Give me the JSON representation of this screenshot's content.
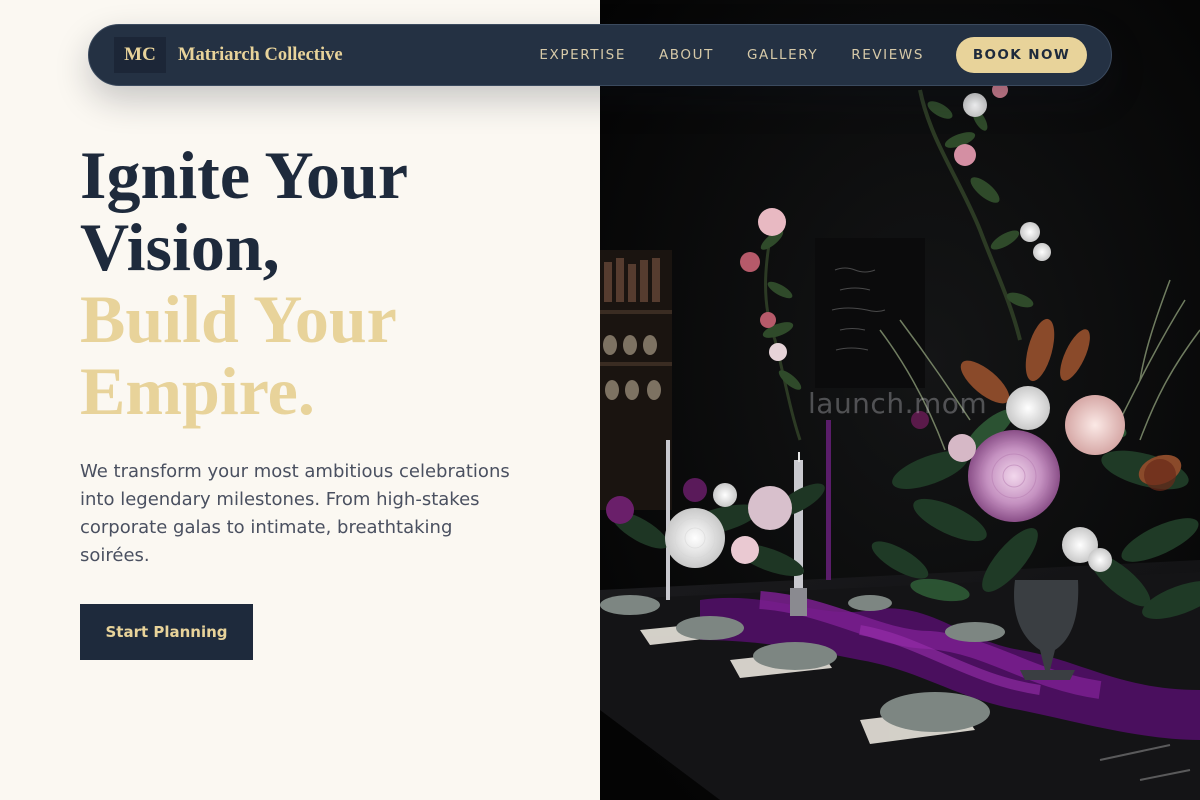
{
  "brand": {
    "mark": "MC",
    "name": "Matriarch Collective"
  },
  "nav": {
    "links": [
      "EXPERTISE",
      "ABOUT",
      "GALLERY",
      "REVIEWS"
    ],
    "cta_label": "BOOK NOW"
  },
  "hero": {
    "headline_dark": [
      "Ignite Your",
      "Vision,"
    ],
    "headline_gold": [
      "Build Your",
      "Empire."
    ],
    "description": "We transform your most ambitious celebrations into legendary milestones. From high-stakes corporate galas to intimate, breathtaking soirées.",
    "cta_label": "Start Planning"
  },
  "photo": {
    "watermark": "launch.mom"
  },
  "colors": {
    "navy": "#1e2a3c",
    "gold": "#e8d39a",
    "cream": "#fbf8f2",
    "body_text": "#4a5060"
  }
}
